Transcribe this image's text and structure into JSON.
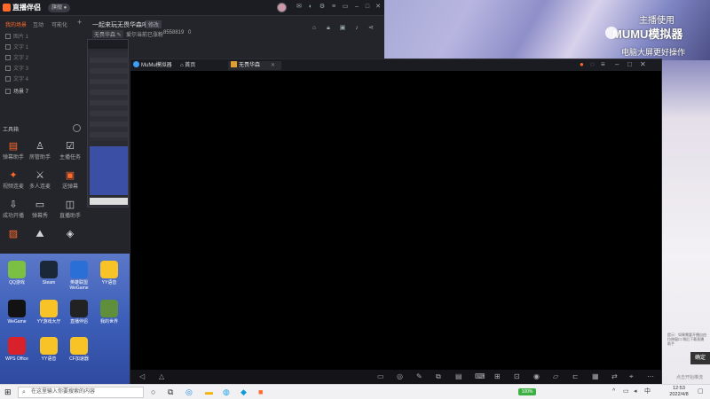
{
  "live_app": {
    "name": "直播伴侣",
    "badge": "旗舰 ●",
    "tabs": [
      "我的场景",
      "互动",
      "可能化"
    ],
    "scenes": [
      "图片 1",
      "文字 1",
      "文字 2",
      "文字 3",
      "文字 4",
      "场景 7"
    ],
    "stream_title": "一起来玩无畏华森吧",
    "edit_label": "修改",
    "chips": [
      "无畏华森 ✎",
      "爱尔当前已涨粉",
      "8558819",
      "0"
    ],
    "tools_title": "工具箱",
    "tools": [
      {
        "label": "弹幕助手",
        "hot": true
      },
      {
        "label": "房管助手",
        "hot": false
      },
      {
        "label": "主播任务",
        "hot": false
      },
      {
        "label": "视频连麦",
        "hot": false
      },
      {
        "label": "多人连麦",
        "hot": false
      },
      {
        "label": "送弹幕",
        "hot": true
      },
      {
        "label": "成功开播",
        "hot": false
      },
      {
        "label": "弹幕秀",
        "hot": false
      },
      {
        "label": "直播助手",
        "hot": false
      },
      {
        "label": "",
        "hot": false
      },
      {
        "label": "",
        "hot": false
      },
      {
        "label": "",
        "hot": false
      }
    ]
  },
  "desktop_icons": [
    {
      "label": "QQ游戏",
      "color": "#7bc043"
    },
    {
      "label": "Steam",
      "color": "#1b2838"
    },
    {
      "label": "英雄联盟WeGame",
      "color": "#2a6fd6"
    },
    {
      "label": "YY语音",
      "color": "#f7c326"
    },
    {
      "label": "WeGame",
      "color": "#121212"
    },
    {
      "label": "YY游戏大厅",
      "color": "#f7c326"
    },
    {
      "label": "直播伴侣",
      "color": "#222"
    },
    {
      "label": "我的世界",
      "color": "#5f8f3a"
    },
    {
      "label": "WPS Office",
      "color": "#d8212b"
    },
    {
      "label": "YY语音",
      "color": "#f7c326"
    },
    {
      "label": "CF加速器",
      "color": "#f7c326"
    }
  ],
  "wallpaper": {
    "title_line": "主播使用",
    "brand": "MUMU模拟器",
    "subtitle": "电脑大屏更好操作"
  },
  "mumu": {
    "app_name": "MuMu模拟器",
    "home_tab": "首页",
    "game_tab": "无畏华森"
  },
  "right_panel": {
    "note": "提示：如果需要开播自由拉伸窗口 稍后下载直播助手",
    "button": "确定",
    "footer": "点击开始推流"
  },
  "taskbar": {
    "search_placeholder": "在这里输入你要搜索的内容",
    "battery": "100%",
    "time": "12:53",
    "date": "2022/4/8"
  }
}
